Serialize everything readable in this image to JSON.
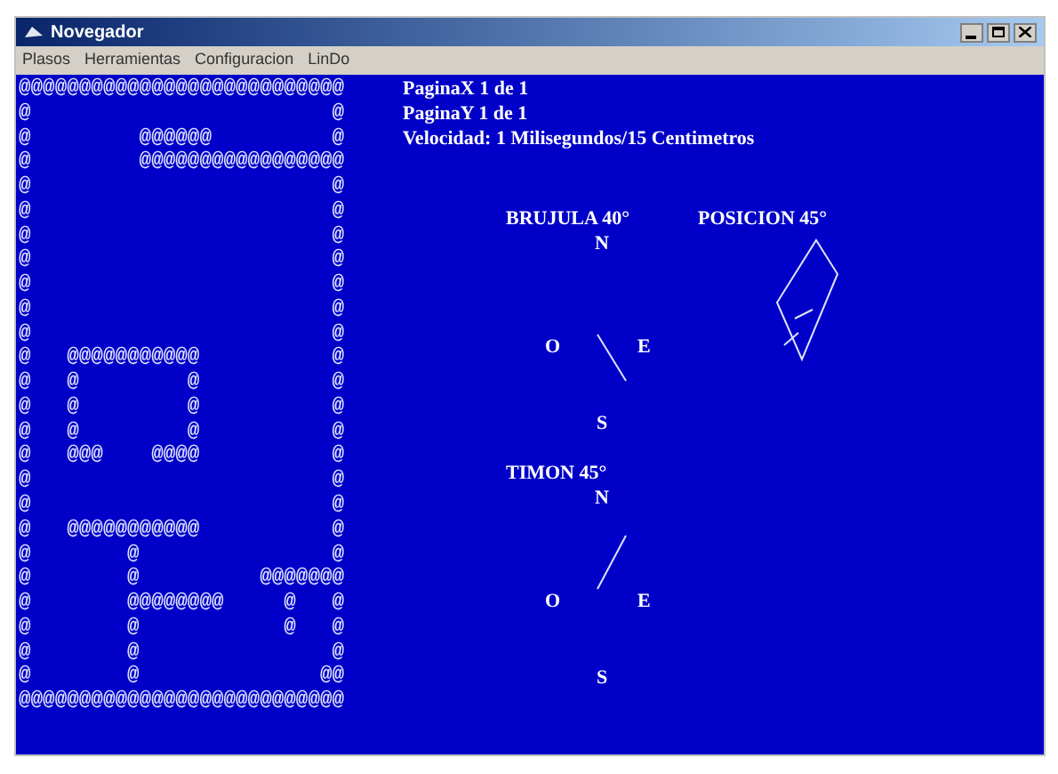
{
  "window": {
    "title": "Novegador"
  },
  "menu": [
    "Plasos",
    "Herramientas",
    "Configuracion",
    "LinDo"
  ],
  "info_lines": [
    "PaginaX 1 de 1",
    "PaginaY 1 de 1",
    "Velocidad: 1 Milisegundos/15 Centimetros"
  ],
  "maze": [
    "@@@@@@@@@@@@@@@@@@@@@@@@@@@",
    "@                         @",
    "@         @@@@@@          @",
    "@         @@@@@@@@@@@@@@@@@",
    "@                         @",
    "@                         @",
    "@                         @",
    "@                         @",
    "@                         @",
    "@                         @",
    "@                         @",
    "@   @@@@@@@@@@@           @",
    "@   @         @           @",
    "@   @         @           @",
    "@   @         @           @",
    "@   @@@    @@@@           @",
    "@                         @",
    "@                         @",
    "@   @@@@@@@@@@@           @",
    "@        @                @",
    "@        @          @@@@@@@",
    "@        @@@@@@@@     @   @",
    "@        @            @   @",
    "@        @                @",
    "@        @               @@",
    "@@@@@@@@@@@@@@@@@@@@@@@@@@@"
  ],
  "compasses": [
    {
      "title": "BRUJULA 40°",
      "north": "N",
      "west": "O",
      "east": "E",
      "south": "S"
    },
    {
      "title": "TIMON 45°",
      "north": "N",
      "west": "O",
      "east": "E",
      "south": "S"
    }
  ],
  "position": {
    "title": "POSICION 45°"
  }
}
